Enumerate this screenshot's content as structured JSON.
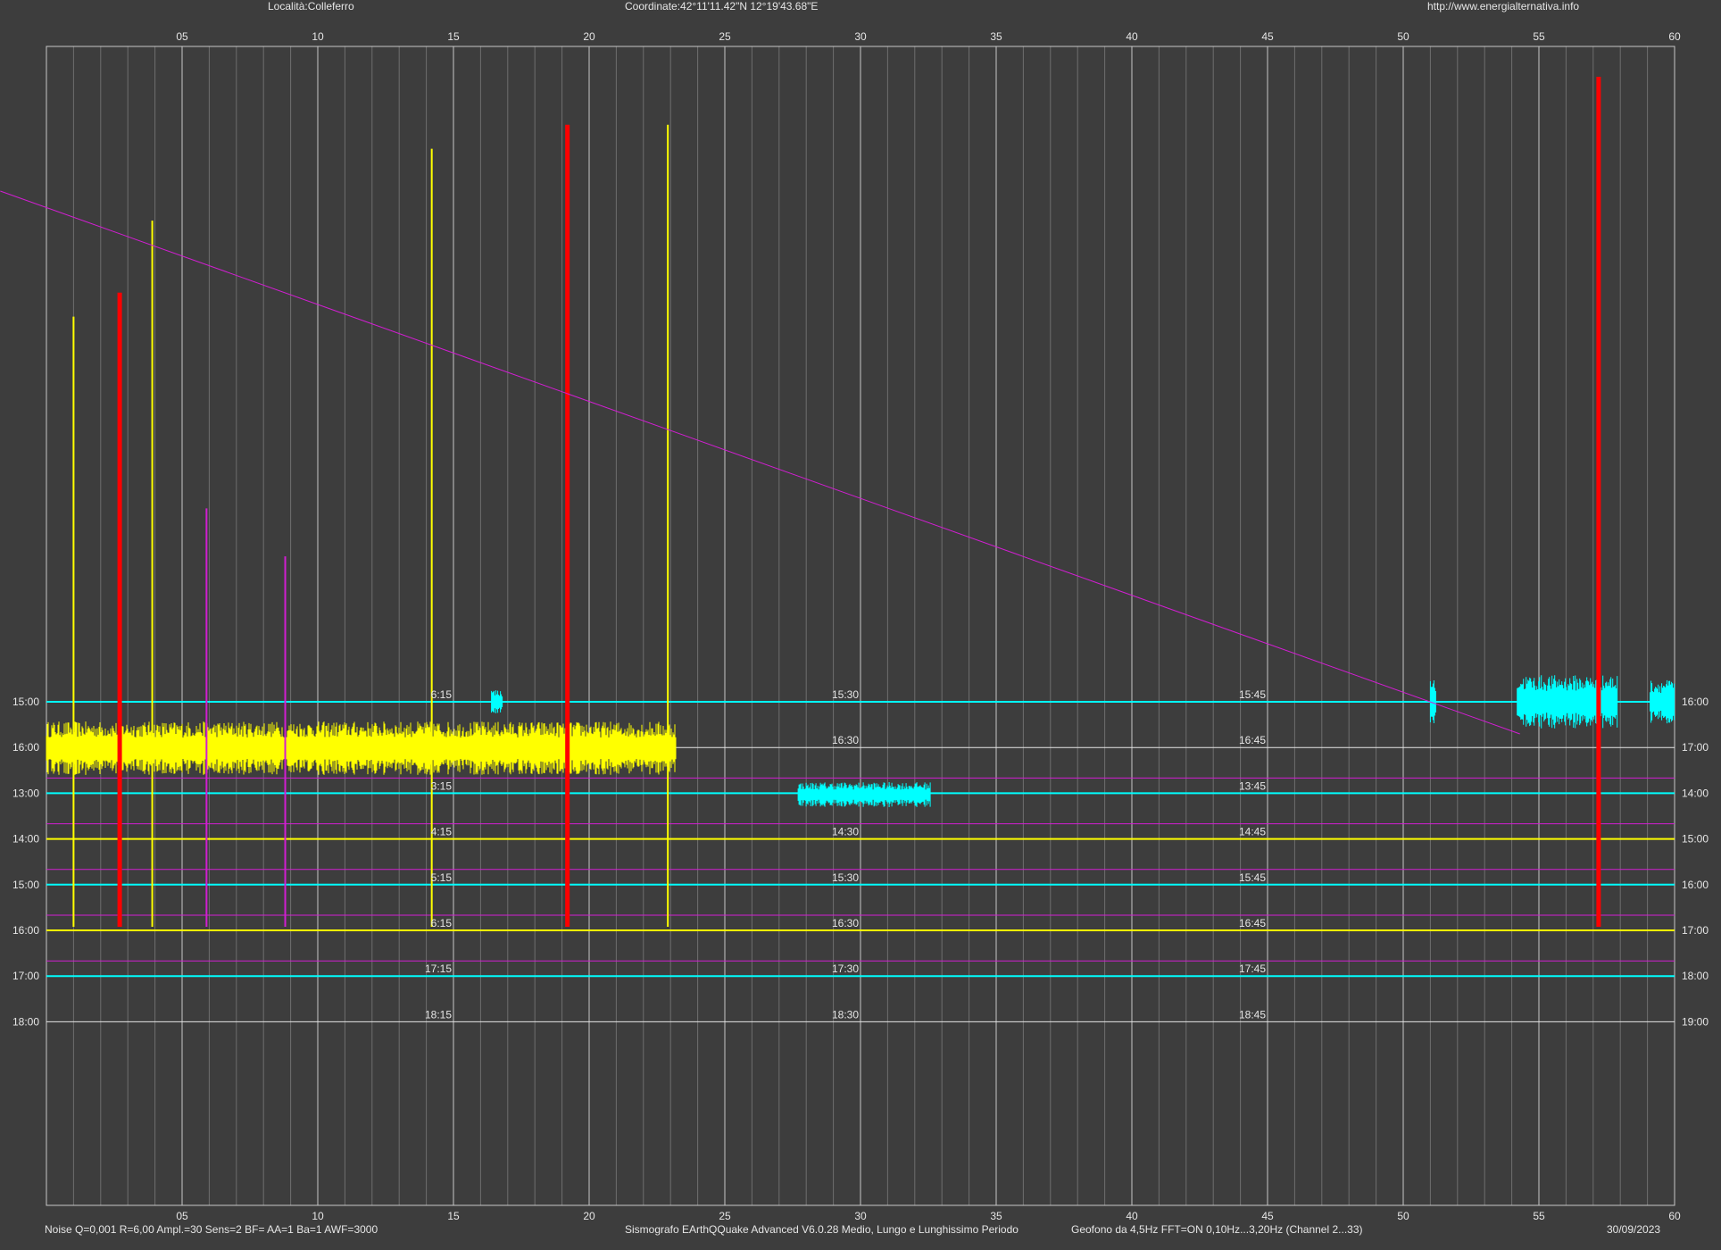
{
  "header": {
    "location": "Località:Colleferro",
    "coordinates": "Coordinate:42°11'11.42\"N  12°19'43.68\"E",
    "url": "http://www.energialternativa.info"
  },
  "footer": {
    "settings": "Noise Q=0,001 R=6,00 Ampl.=30 Sens=2 BF= AA=1 Ba=1 AWF=3000",
    "software": "Sismografo  EArthQQuake Advanced V6.0.28  Medio, Lungo e Lunghissimo Periodo",
    "sensor": "Geofono da 4,5Hz FFT=ON 0,10Hz...3,20Hz      (Channel 2...33)",
    "date": "30/09/2023"
  },
  "chart_data": {
    "type": "line",
    "x_range": [
      0,
      60
    ],
    "x_ticks": [
      "05",
      "10",
      "15",
      "20",
      "25",
      "30",
      "35",
      "40",
      "45",
      "50",
      "55",
      "60"
    ],
    "x_tick_values": [
      5,
      10,
      15,
      20,
      25,
      30,
      35,
      40,
      45,
      50,
      55,
      60
    ],
    "grid": true,
    "colors": {
      "background": "#3d3d3d",
      "grid_major": "#c8c8c8",
      "grid_minor": "#6e6e6e",
      "yellow": "#ffff00",
      "cyan": "#00ffff",
      "magenta": "#d21ed2",
      "red": "#ff0000"
    },
    "rows": [
      {
        "left": "15:00",
        "right": "16:00",
        "marks": [
          "6:15",
          "15:30",
          "15:45"
        ],
        "color": "cyan"
      },
      {
        "left": "16:00",
        "right": "17:00",
        "marks": [
          "",
          "16:30",
          "16:45"
        ],
        "color": "white"
      },
      {
        "left": "13:00",
        "right": "14:00",
        "marks": [
          "3:15",
          "",
          "13:45"
        ],
        "color": "cyan"
      },
      {
        "left": "14:00",
        "right": "15:00",
        "marks": [
          "4:15",
          "14:30",
          "14:45"
        ],
        "color": "yellow"
      },
      {
        "left": "15:00",
        "right": "16:00",
        "marks": [
          "5:15",
          "15:30",
          "15:45"
        ],
        "color": "cyan"
      },
      {
        "left": "16:00",
        "right": "17:00",
        "marks": [
          "6:15",
          "16:30",
          "16:45"
        ],
        "color": "yellow"
      },
      {
        "left": "17:00",
        "right": "18:00",
        "marks": [
          "17:15",
          "17:30",
          "17:45"
        ],
        "color": "cyan"
      },
      {
        "left": "18:00",
        "right": "19:00",
        "marks": [
          "18:15",
          "18:30",
          "18:45"
        ],
        "color": "white"
      }
    ],
    "events": [
      {
        "x": 1.0,
        "peak": 0.9,
        "color": "yellow"
      },
      {
        "x": 2.7,
        "peak": 0.95,
        "color": "red"
      },
      {
        "x": 3.9,
        "peak": 1.1,
        "color": "yellow"
      },
      {
        "x": 5.9,
        "peak": 0.5,
        "color": "magenta"
      },
      {
        "x": 8.8,
        "peak": 0.4,
        "color": "magenta"
      },
      {
        "x": 14.2,
        "peak": 1.25,
        "color": "yellow"
      },
      {
        "x": 19.2,
        "peak": 1.3,
        "color": "red"
      },
      {
        "x": 22.9,
        "peak": 1.3,
        "color": "yellow"
      },
      {
        "x": 57.2,
        "peak": 1.4,
        "color": "red"
      }
    ],
    "trend_line": {
      "x_start": -1.7,
      "x_end": 54.3,
      "color": "magenta"
    }
  }
}
